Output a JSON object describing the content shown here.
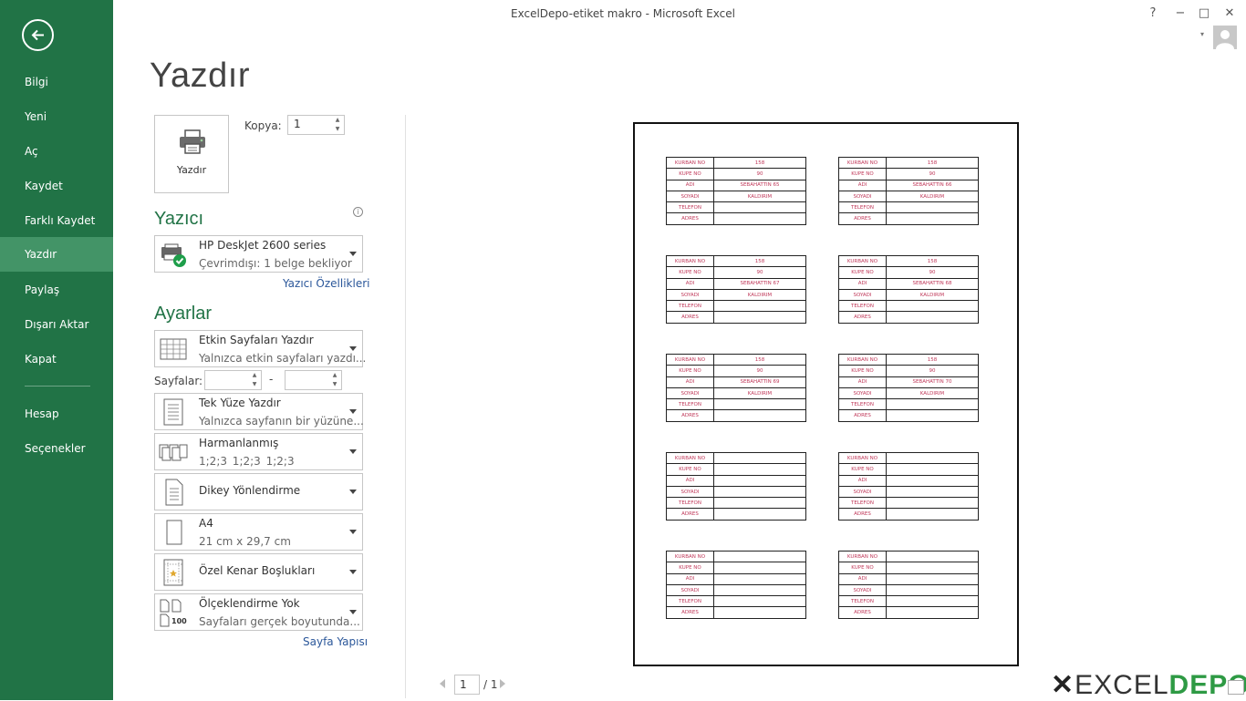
{
  "window": {
    "title": "ExcelDepo-etiket makro - Microsoft Excel",
    "help": "?",
    "minimize": "−",
    "maximize": "□",
    "close": "✕"
  },
  "sidebar": {
    "items": [
      {
        "label": "Bilgi"
      },
      {
        "label": "Yeni"
      },
      {
        "label": "Aç"
      },
      {
        "label": "Kaydet"
      },
      {
        "label": "Farklı Kaydet"
      },
      {
        "label": "Yazdır",
        "active": true
      },
      {
        "label": "Paylaş"
      },
      {
        "label": "Dışarı Aktar"
      },
      {
        "label": "Kapat"
      },
      {
        "label": "Hesap"
      },
      {
        "label": "Seçenekler"
      }
    ]
  },
  "page": {
    "title": "Yazdır"
  },
  "print": {
    "button_label": "Yazdır",
    "copies_label": "Kopya:",
    "copies_value": "1"
  },
  "printer": {
    "section_title": "Yazıcı",
    "name": "HP DeskJet 2600 series",
    "status": "Çevrimdışı: 1 belge bekliyor",
    "properties_link": "Yazıcı Özellikleri"
  },
  "settings": {
    "section_title": "Ayarlar",
    "pages_label": "Sayfalar:",
    "pages_from": "",
    "pages_to": "",
    "pages_dash": "-",
    "page_setup_link": "Sayfa Yapısı",
    "options": [
      {
        "title": "Etkin Sayfaları Yazdır",
        "subtitle": "Yalnızca etkin sayfaları yazdı..."
      },
      {
        "title": "Tek Yüze Yazdır",
        "subtitle": "Yalnızca sayfanın bir yüzüne..."
      },
      {
        "title": "Harmanlanmış",
        "subtitle": "1;2;3    1;2;3    1;2;3"
      },
      {
        "title": "Dikey Yönlendirme",
        "subtitle": ""
      },
      {
        "title": "A4",
        "subtitle": "21 cm x 29,7 cm"
      },
      {
        "title": "Özel Kenar Boşlukları",
        "subtitle": ""
      },
      {
        "title": "Ölçeklendirme Yok",
        "subtitle": "Sayfaları gerçek boyutunda..."
      }
    ],
    "scaling_icon_text": "100"
  },
  "preview": {
    "field_labels": [
      "KURBAN NO",
      "KUPE NO",
      "ADI",
      "SOYADI",
      "TELEFON",
      "ADRES"
    ],
    "labels": [
      {
        "values": [
          "158",
          "90",
          "SEBAHATTIN 65",
          "KALDIRIM",
          "",
          ""
        ]
      },
      {
        "values": [
          "158",
          "90",
          "SEBAHATTIN 66",
          "KALDIRIM",
          "",
          ""
        ]
      },
      {
        "values": [
          "158",
          "90",
          "SEBAHATTIN 67",
          "KALDIRIM",
          "",
          ""
        ]
      },
      {
        "values": [
          "158",
          "90",
          "SEBAHATTIN 68",
          "KALDIRIM",
          "",
          ""
        ]
      },
      {
        "values": [
          "158",
          "90",
          "SEBAHATTIN 69",
          "KALDIRIM",
          "",
          ""
        ]
      },
      {
        "values": [
          "158",
          "90",
          "SEBAHATTIN 70",
          "KALDIRIM",
          "",
          ""
        ]
      },
      {
        "values": [
          "",
          "",
          "",
          "",
          "",
          ""
        ]
      },
      {
        "values": [
          "",
          "",
          "",
          "",
          "",
          ""
        ]
      },
      {
        "values": [
          "",
          "",
          "",
          "",
          "",
          ""
        ]
      },
      {
        "values": [
          "",
          "",
          "",
          "",
          "",
          ""
        ]
      }
    ]
  },
  "page_nav": {
    "current": "1",
    "total": "/ 1"
  },
  "watermark": {
    "x": "✕",
    "part1": "EXCEL",
    "part2": "DEPO"
  }
}
